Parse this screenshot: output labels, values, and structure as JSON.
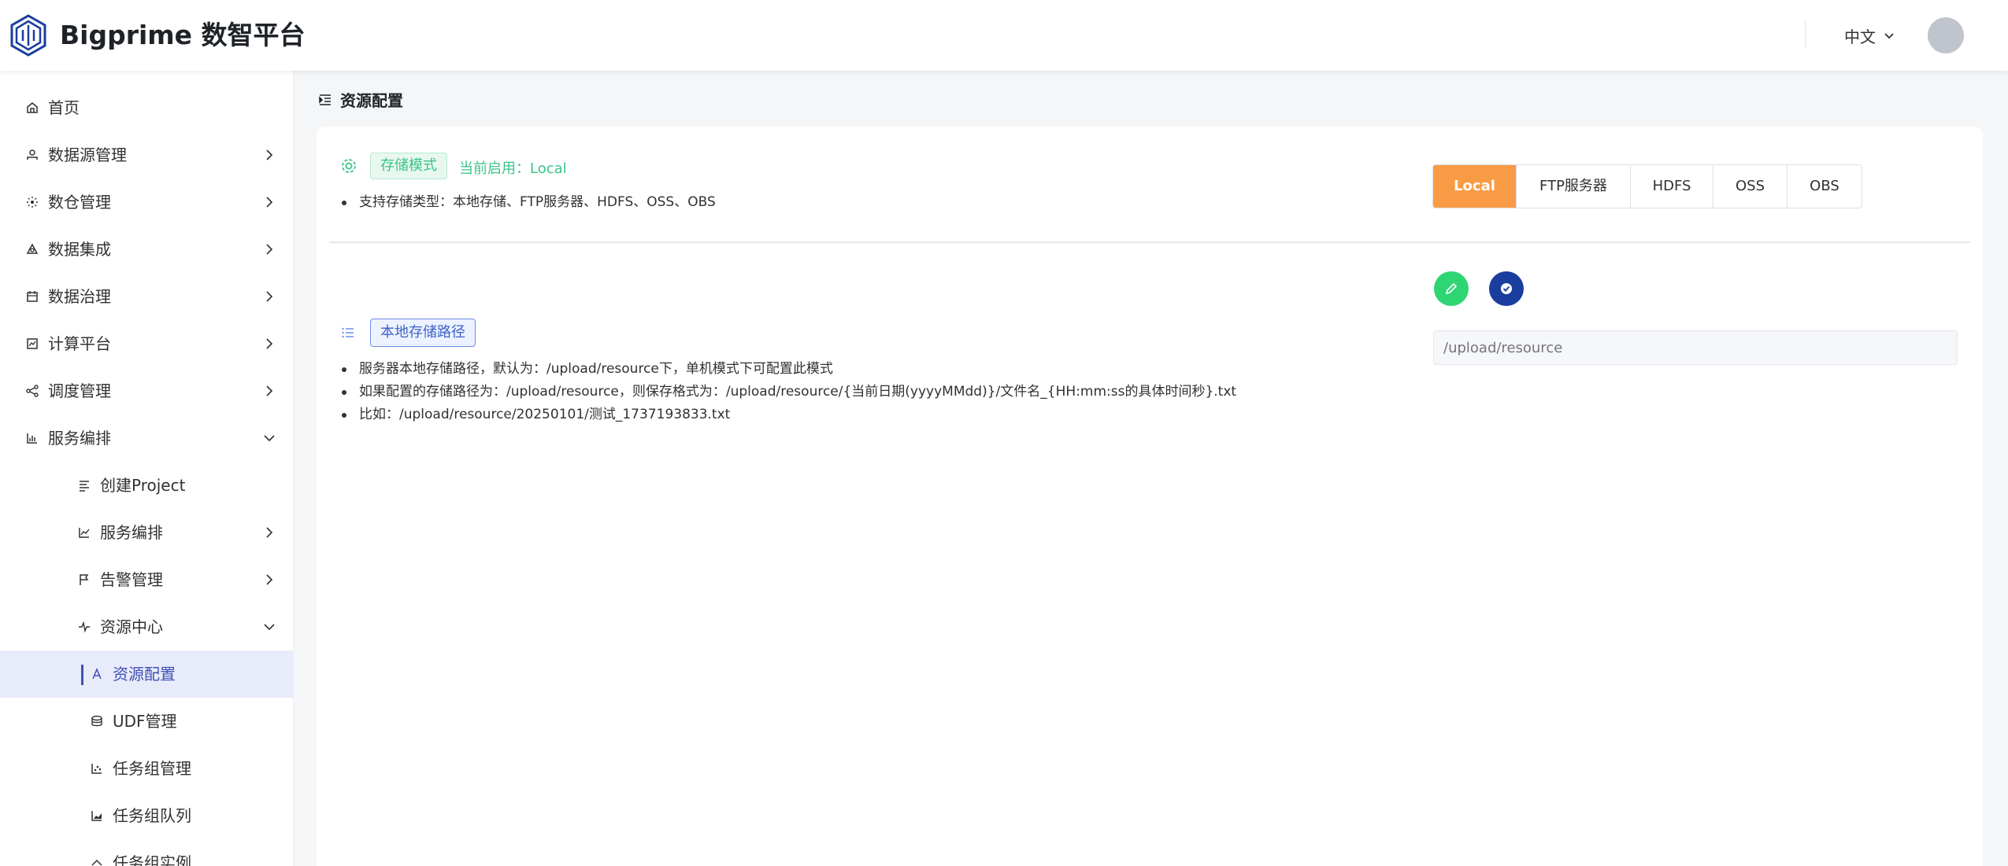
{
  "header": {
    "brand": "Bigprime 数智平台",
    "language": "中文",
    "logo_icon": "hexagon-logo-icon",
    "avatar_color": "#c0c4cc"
  },
  "sidebar": {
    "items": [
      {
        "label": "首页",
        "icon": "home-icon"
      },
      {
        "label": "数据源管理",
        "icon": "datasource-icon"
      },
      {
        "label": "数仓管理",
        "icon": "warehouse-icon"
      },
      {
        "label": "数据集成",
        "icon": "integration-icon"
      },
      {
        "label": "数据治理",
        "icon": "governance-icon"
      },
      {
        "label": "计算平台",
        "icon": "compute-icon"
      },
      {
        "label": "调度管理",
        "icon": "schedule-icon"
      },
      {
        "label": "服务编排",
        "icon": "chart-icon"
      },
      {
        "label": "创建Project",
        "icon": "align-icon"
      },
      {
        "label": "服务编排",
        "icon": "line-chart-icon"
      },
      {
        "label": "告警管理",
        "icon": "flag-icon"
      },
      {
        "label": "资源中心",
        "icon": "pulse-icon"
      },
      {
        "label": "资源配置",
        "icon": "text-icon"
      },
      {
        "label": "UDF管理",
        "icon": "database-icon"
      },
      {
        "label": "任务组管理",
        "icon": "scatter-icon"
      },
      {
        "label": "任务组队列",
        "icon": "bar-chart-icon"
      },
      {
        "label": "任务组实例",
        "icon": "arrow-icon"
      }
    ]
  },
  "page": {
    "title": "资源配置"
  },
  "storage": {
    "tag": "存储模式",
    "current_label": "当前启用：Local",
    "supported": "支持存储类型：本地存储、FTP服务器、HDFS、OSS、OBS",
    "modes": [
      "Local",
      "FTP服务器",
      "HDFS",
      "OSS",
      "OBS"
    ],
    "active_mode": "Local",
    "accent_color": "#f99b45"
  },
  "local_path": {
    "tag": "本地存储路径",
    "notes": [
      "服务器本地存储路径，默认为：/upload/resource下，单机模式下可配置此模式",
      "如果配置的存储路径为：/upload/resource，则保存格式为：/upload/resource/{当前日期(yyyyMMdd)}/文件名_{HH:mm:ss的具体时间秒}.txt",
      "比如：/upload/resource/20250101/测试_1737193833.txt"
    ],
    "input_placeholder": "/upload/resource",
    "edit_icon": "pencil-icon",
    "confirm_icon": "check-circle-icon"
  }
}
